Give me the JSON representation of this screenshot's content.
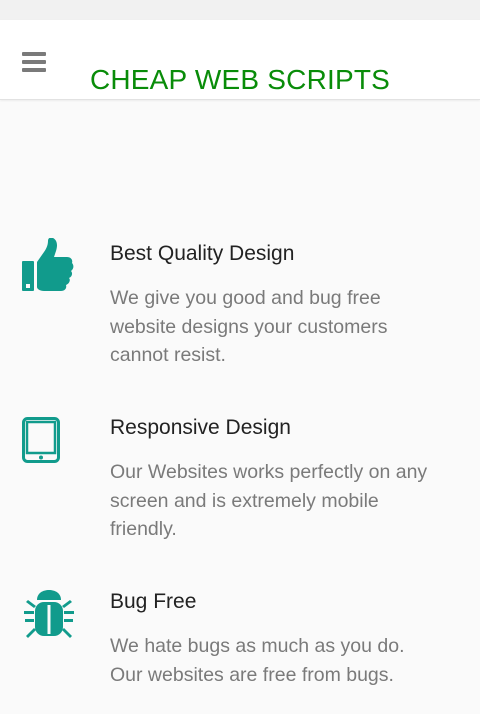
{
  "header": {
    "title": "CHEAP WEB SCRIPTS",
    "menu_icon": "hamburger-menu-icon"
  },
  "colors": {
    "brand_title": "#098c09",
    "icon_accent": "#119b8c",
    "body_text": "#7a7a7a",
    "heading_text": "#222222"
  },
  "features": [
    {
      "icon": "thumbs-up-icon",
      "title": "Best Quality Design",
      "text": "We give you good and bug free website designs your customers cannot resist."
    },
    {
      "icon": "tablet-icon",
      "title": "Responsive Design",
      "text": "Our Websites works perfectly on any screen and is extremely mobile friendly."
    },
    {
      "icon": "bug-icon",
      "title": "Bug Free",
      "text": "We hate bugs as much as you do. Our websites are free from bugs."
    }
  ]
}
